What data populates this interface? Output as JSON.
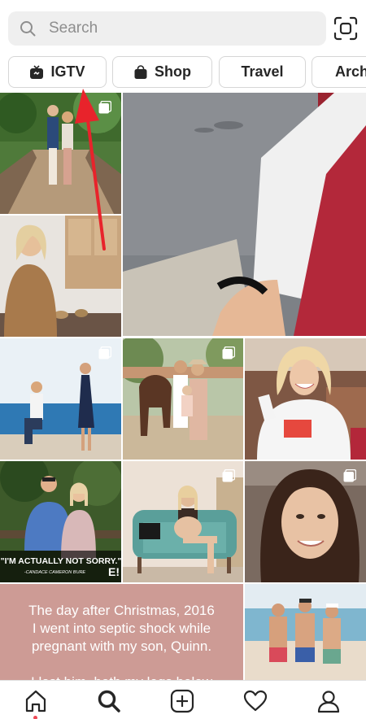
{
  "search": {
    "placeholder": "Search"
  },
  "chips": [
    {
      "label": "IGTV",
      "icon": "tv-icon"
    },
    {
      "label": "Shop",
      "icon": "shopping-bag-icon"
    },
    {
      "label": "Travel"
    },
    {
      "label": "Arch"
    }
  ],
  "tiles": {
    "quote_main": "\"I'M ACTUALLY NOT SORRY.\"",
    "quote_attribution": "-CANDACE CAMERON BURE",
    "quote_brand": "E!",
    "text_post_lines": [
      "The day after Christmas, 2016",
      "I went into septic shock while",
      "pregnant with my son, Quinn.",
      "",
      "I lost him, both my legs below"
    ]
  },
  "colors": {
    "annotation_arrow": "#e8232b",
    "text_tile_bg": "#cd9b95",
    "notification_dot": "#ed4956"
  },
  "bottom_nav": [
    {
      "name": "home",
      "icon": "home-icon"
    },
    {
      "name": "search",
      "icon": "search-icon"
    },
    {
      "name": "new-post",
      "icon": "plus-square-icon"
    },
    {
      "name": "activity",
      "icon": "heart-icon"
    },
    {
      "name": "profile",
      "icon": "user-icon"
    }
  ]
}
